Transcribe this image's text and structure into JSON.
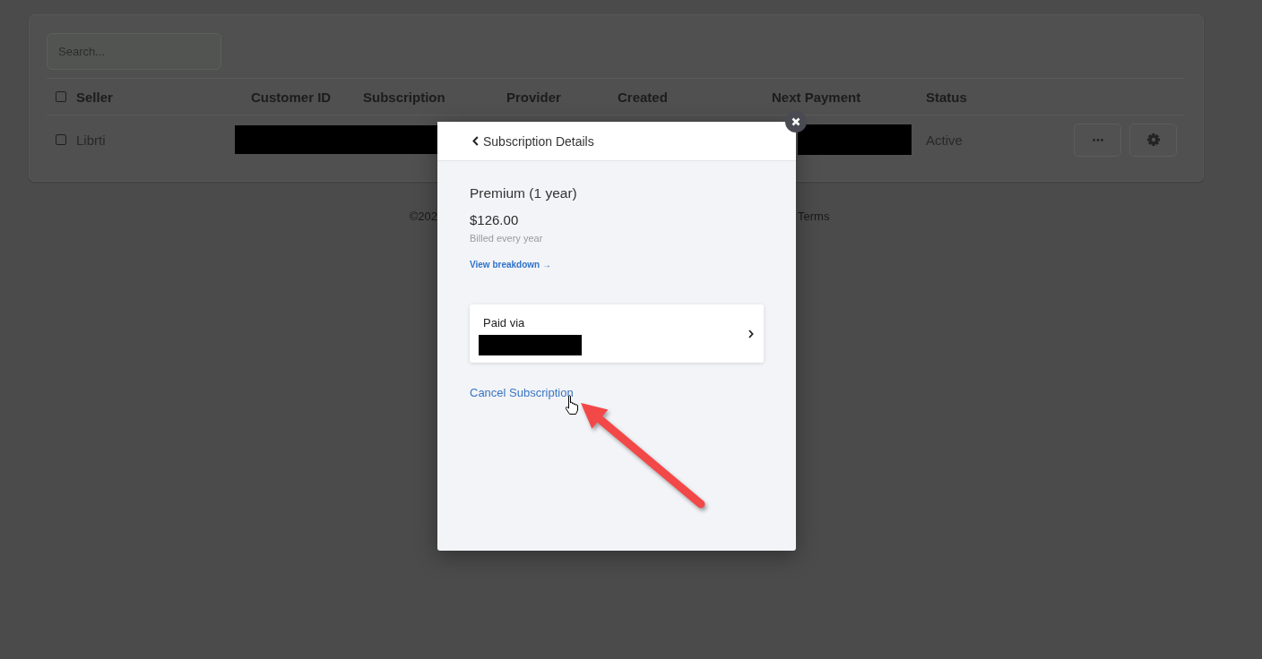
{
  "search": {
    "placeholder": "Search..."
  },
  "table": {
    "select_all": {
      "checked": false
    },
    "columns": [
      "Seller",
      "Customer ID",
      "Subscription",
      "Provider",
      "Created",
      "Next Payment",
      "Status"
    ],
    "rows": [
      {
        "checked": false,
        "seller": "Librti",
        "status": "Active"
      }
    ]
  },
  "footer": {
    "copyright": "©202",
    "link": "Terms"
  },
  "dialog": {
    "title": "Subscription Details",
    "plan": "Premium (1 year)",
    "price": "$126.00",
    "billing": "Billed every year",
    "breakdown_link": "View breakdown →",
    "payment": {
      "label": "Paid via"
    },
    "cancel_link": "Cancel Subscription"
  }
}
